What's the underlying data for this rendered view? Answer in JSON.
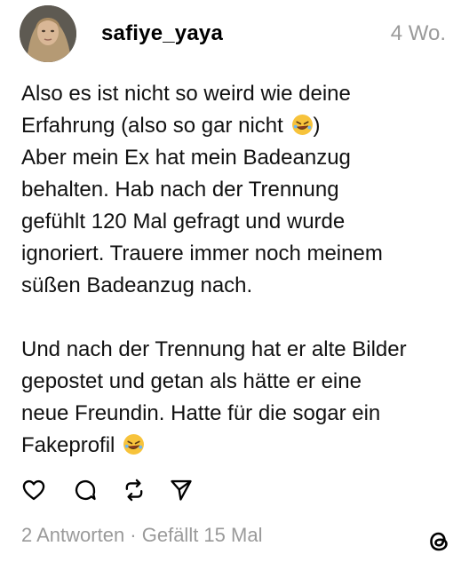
{
  "post": {
    "username": "safiye_yaya",
    "timestamp": "4 Wo.",
    "paragraph1_lines": [
      "Also es ist nicht so weird wie deine",
      "Erfahrung (also so gar nicht ",
      "Aber mein Ex hat mein Badeanzug",
      "behalten. Hab nach der Trennung",
      "gefühlt 120 Mal gefragt und wurde",
      "ignoriert. Trauere immer noch meinem",
      "süßen Badeanzug nach."
    ],
    "line2_suffix": ")",
    "paragraph2_lines": [
      "Und nach der Trennung hat er alte Bilder",
      "gepostet und getan als hätte er eine",
      "neue Freundin. Hatte für die sogar ein",
      "Fakeprofil "
    ],
    "emoji": "rolling-on-floor-laughing-emoji"
  },
  "actions": {
    "like_icon": "heart-icon",
    "reply_icon": "comment-icon",
    "repost_icon": "repost-icon",
    "share_icon": "send-icon"
  },
  "footer": {
    "stats": "2 Antworten · Gefällt 15 Mal",
    "logo_icon": "threads-logo-icon"
  }
}
